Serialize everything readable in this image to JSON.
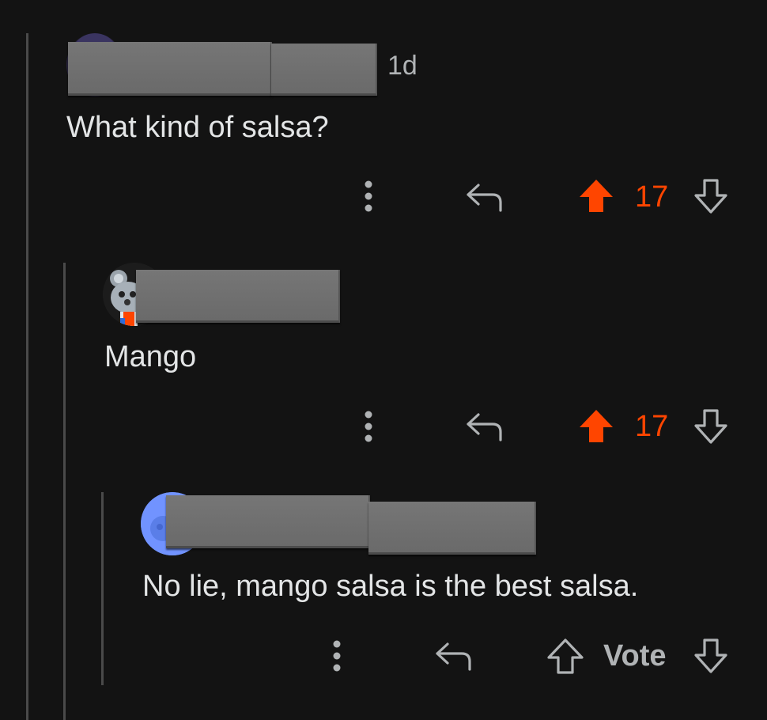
{
  "comments": [
    {
      "age": "1d",
      "body": "What kind of salsa?",
      "score": "17",
      "vote_state": "upvoted"
    },
    {
      "age": "",
      "body": "Mango",
      "score": "17",
      "vote_state": "upvoted"
    },
    {
      "age": "",
      "body": "No lie, mango salsa is the best salsa.",
      "score": "Vote",
      "vote_state": "none"
    }
  ],
  "colors": {
    "background": "#131313",
    "upvote": "#ff4500",
    "icon": "#b0b3b5",
    "thread_line": "#4a4a4a",
    "redaction": "#707070"
  },
  "icons": {
    "more": "more-vertical-icon",
    "reply": "reply-arrow-icon",
    "upvote": "upvote-arrow-icon",
    "downvote": "downvote-arrow-icon"
  }
}
